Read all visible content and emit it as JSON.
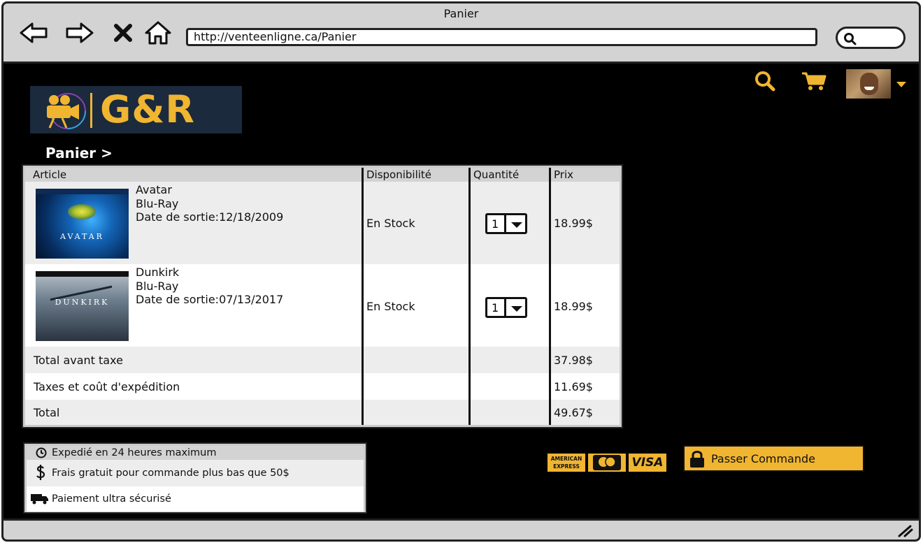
{
  "window": {
    "title": "Panier",
    "url": "http://venteenligne.ca/Panier"
  },
  "brand": {
    "logo_text": "G&R",
    "accent_color": "#f0b531"
  },
  "breadcrumb": "Panier >",
  "table": {
    "headers": [
      "Article",
      "Disponibilité",
      "Quantité",
      "Prix"
    ],
    "items": [
      {
        "title": "Avatar",
        "format": "Blu-Ray",
        "release": "Date de sortie:12/18/2009",
        "availability": "En Stock",
        "quantity": "1",
        "price": "18.99$",
        "cover_title": "AVATAR"
      },
      {
        "title": "Dunkirk",
        "format": "Blu-Ray",
        "release": "Date de sortie:07/13/2017",
        "availability": "En Stock",
        "quantity": "1",
        "price": "18.99$",
        "cover_title": "DUNKIRK"
      }
    ],
    "subtotal_label": "Total avant taxe",
    "subtotal": "37.98$",
    "tax_label": "Taxes et coût d'expédition",
    "tax": "11.69$",
    "total_label": "Total",
    "total": "49.67$"
  },
  "info": {
    "shipping": "Expedié en 24 heures maximum",
    "free_fee": "Frais gratuit pour commande plus bas que 50$",
    "secure": "Paiement ultra sécurisé"
  },
  "payment": {
    "amex": "AMERICAN EXPRESS",
    "visa": "VISA"
  },
  "order_button": "Passer Commande"
}
